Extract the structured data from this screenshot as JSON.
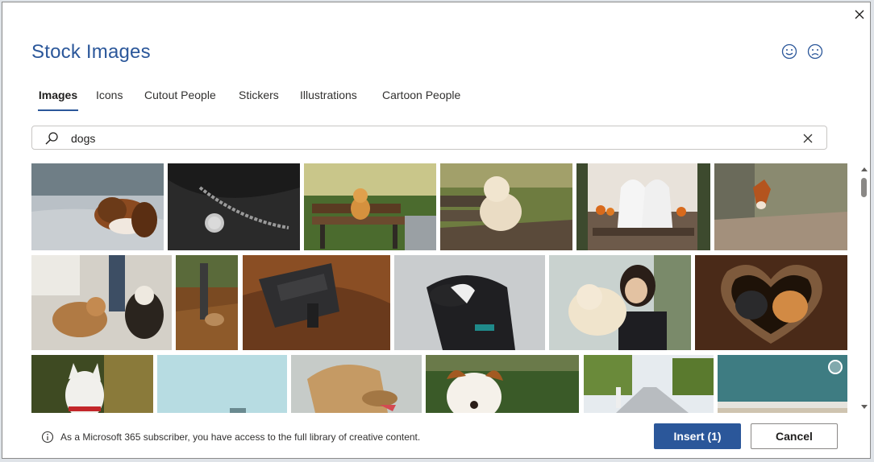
{
  "dialog": {
    "title": "Stock Images",
    "close_icon": "close-icon",
    "feedback": {
      "smile_icon": "smile-icon",
      "frown_icon": "frown-icon"
    }
  },
  "tabs": [
    {
      "label": "Images",
      "active": true
    },
    {
      "label": "Icons",
      "active": false
    },
    {
      "label": "Cutout People",
      "active": false
    },
    {
      "label": "Stickers",
      "active": false
    },
    {
      "label": "Illustrations",
      "active": false
    },
    {
      "label": "Cartoon People",
      "active": false
    }
  ],
  "search": {
    "value": "dogs",
    "icon": "search-icon",
    "clear_icon": "clear-icon"
  },
  "gallery": {
    "selected_count": 1,
    "images": [
      {
        "subject": "basset-hound-lying-on-sofa",
        "selected": true
      },
      {
        "subject": "black-dog-chain-collar-tag",
        "selected": false
      },
      {
        "subject": "corgi-puppy-on-park-bench",
        "selected": false
      },
      {
        "subject": "labrador-on-wooden-bench",
        "selected": false
      },
      {
        "subject": "dogs-in-ghost-costumes-porch",
        "selected": false
      },
      {
        "subject": "fox-peeking-behind-tree",
        "selected": false
      },
      {
        "subject": "beagles-on-leashes",
        "selected": false
      },
      {
        "subject": "dog-walk-autumn-leaves",
        "selected": false
      },
      {
        "subject": "service-dog-vest",
        "selected": false
      },
      {
        "subject": "black-dog-profile",
        "selected": false
      },
      {
        "subject": "woman-hugging-golden-dog",
        "selected": false
      },
      {
        "subject": "dogs-in-heart-blanket",
        "selected": false
      },
      {
        "subject": "white-dog-red-collar",
        "selected": false
      },
      {
        "subject": "light-blue-sky",
        "selected": false
      },
      {
        "subject": "windblown-dog-ears",
        "selected": false
      },
      {
        "subject": "jack-russell-on-grass",
        "selected": false
      },
      {
        "subject": "city-street-walking-dog",
        "selected": false
      },
      {
        "subject": "beach-sea-horizon",
        "selected": false
      }
    ]
  },
  "footer": {
    "info_icon": "info-icon",
    "info_text": "As a Microsoft 365 subscriber, you have access to the full library of creative content.",
    "insert_label": "Insert (1)",
    "cancel_label": "Cancel"
  },
  "colors": {
    "accent": "#2b579a",
    "text": "#323130",
    "border": "#c8c6c4"
  }
}
